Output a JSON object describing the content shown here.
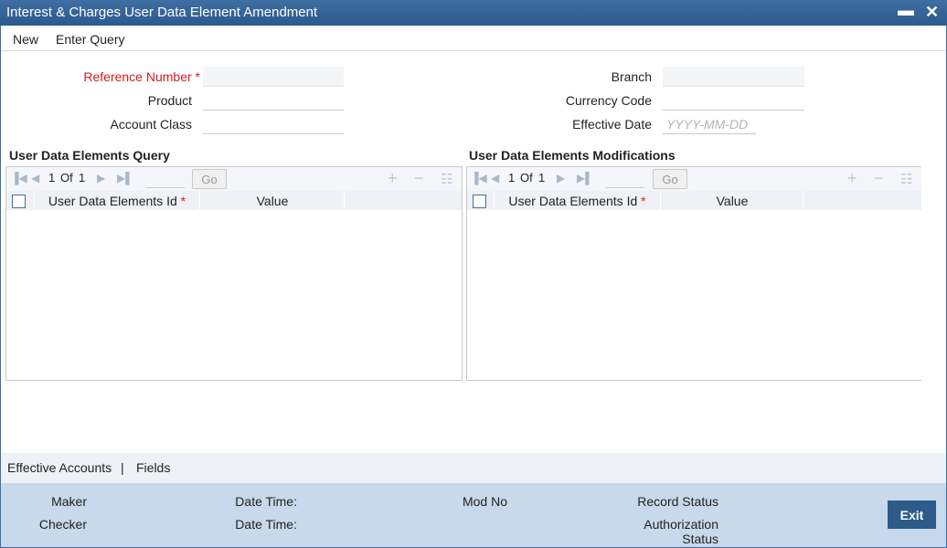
{
  "window": {
    "title": "Interest & Charges User Data Element Amendment",
    "minimize": "▬",
    "close": "✕"
  },
  "menu": {
    "new": "New",
    "enter_query": "Enter Query"
  },
  "form": {
    "reference_number": {
      "label": "Reference Number",
      "required_mark": "*",
      "value": ""
    },
    "product": {
      "label": "Product",
      "value": ""
    },
    "account_class": {
      "label": "Account Class",
      "value": ""
    },
    "branch": {
      "label": "Branch",
      "value": ""
    },
    "currency_code": {
      "label": "Currency Code",
      "value": ""
    },
    "effective_date": {
      "label": "Effective Date",
      "placeholder": "YYYY-MM-DD",
      "value": ""
    }
  },
  "query_grid": {
    "title": "User Data Elements Query",
    "pager": {
      "current": "1",
      "of": "Of",
      "total": "1",
      "go": "Go"
    },
    "columns": [
      "User Data Elements Id",
      "Value"
    ],
    "required_mark": "*"
  },
  "mod_grid": {
    "title": "User Data Elements Modifications",
    "pager": {
      "current": "1",
      "of": "Of",
      "total": "1",
      "go": "Go"
    },
    "columns": [
      "User Data Elements Id",
      "Value"
    ],
    "required_mark": "*"
  },
  "subtabs": {
    "effective_accounts": "Effective Accounts",
    "separator": "|",
    "fields": "Fields"
  },
  "audit": {
    "maker": "Maker",
    "checker": "Checker",
    "date_time_1": "Date Time:",
    "date_time_2": "Date Time:",
    "mod_no": "Mod No",
    "record_status": "Record Status",
    "authorization_status_1": "Authorization",
    "authorization_status_2": "Status"
  },
  "exit_label": "Exit"
}
